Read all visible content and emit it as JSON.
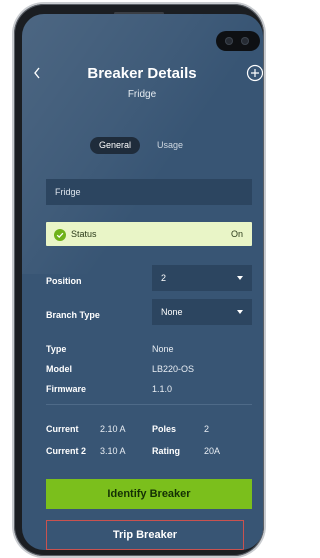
{
  "header": {
    "title": "Breaker Details",
    "subtitle": "Fridge"
  },
  "tabs": [
    {
      "label": "General",
      "active": true
    },
    {
      "label": "Usage",
      "active": false
    }
  ],
  "name_field": {
    "value": "Fridge"
  },
  "status": {
    "label": "Status",
    "value": "On",
    "color": "#e9f5c7",
    "icon": "check-circle-icon"
  },
  "position": {
    "label": "Position",
    "value": "2"
  },
  "branch_type": {
    "label": "Branch Type",
    "value": "None"
  },
  "info": {
    "type_label": "Type",
    "type_value": "None",
    "model_label": "Model",
    "model_value": "LB220-OS",
    "firmware_label": "Firmware",
    "firmware_value": "1.1.0"
  },
  "electrical": {
    "current_label": "Current",
    "current_value": "2.10 A",
    "current2_label": "Current 2",
    "current2_value": "3.10 A",
    "poles_label": "Poles",
    "poles_value": "2",
    "rating_label": "Rating",
    "rating_value": "20A"
  },
  "actions": {
    "identify_label": "Identify Breaker",
    "identify_color": "#7bbf1c",
    "trip_label": "Trip Breaker",
    "trip_border_color": "#c9524f"
  },
  "colors": {
    "screen_background": "#385574",
    "field_background": "#2c4560"
  }
}
